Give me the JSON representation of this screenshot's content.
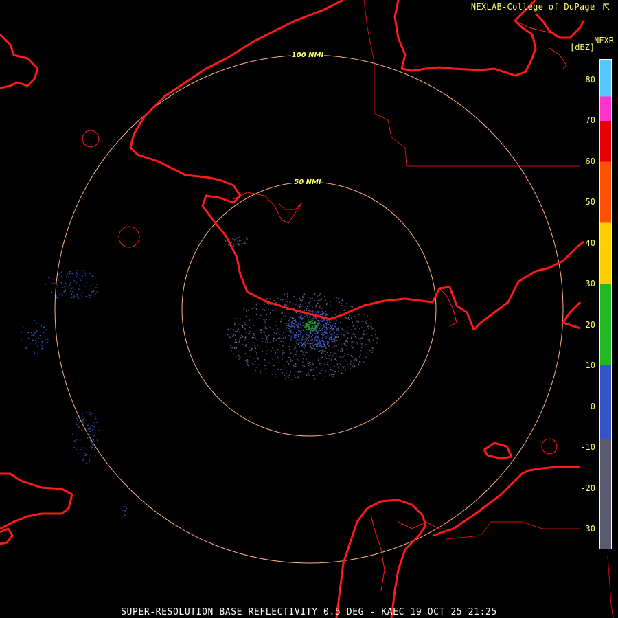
{
  "header": {
    "credit": "NEXLAB-College of DuPage",
    "product_code": "NEXR",
    "unit": "[dBZ]"
  },
  "rings": [
    {
      "label": "100 NMI"
    },
    {
      "label": "50 NMI"
    }
  ],
  "scale": {
    "ticks": [
      "80",
      "70",
      "60",
      "50",
      "40",
      "30",
      "20",
      "10",
      "0",
      "-10",
      "-20",
      "-30"
    ],
    "min_dbz": -35,
    "max_dbz": 85,
    "bands": [
      {
        "from": -35,
        "to": -8,
        "color": "#5a5a70"
      },
      {
        "from": -8,
        "to": 10,
        "color": "#3455c8"
      },
      {
        "from": 10,
        "to": 30,
        "color": "#22b822"
      },
      {
        "from": 30,
        "to": 45,
        "color": "#ffd000"
      },
      {
        "from": 45,
        "to": 60,
        "color": "#ff5000"
      },
      {
        "from": 60,
        "to": 70,
        "color": "#e60000"
      },
      {
        "from": 70,
        "to": 76,
        "color": "#ff33cc"
      },
      {
        "from": 76,
        "to": 85,
        "color": "#55c8ff"
      }
    ]
  },
  "colors": {
    "coast": "#ff1a1a",
    "state_border": "#cc1111",
    "range_ring": "#ffb08a",
    "ring_label": "#ffff66"
  },
  "footer": {
    "text": "SUPER-RESOLUTION BASE REFLECTIVITY 0.5 DEG - KAEC 19 OCT 25 21:25"
  }
}
